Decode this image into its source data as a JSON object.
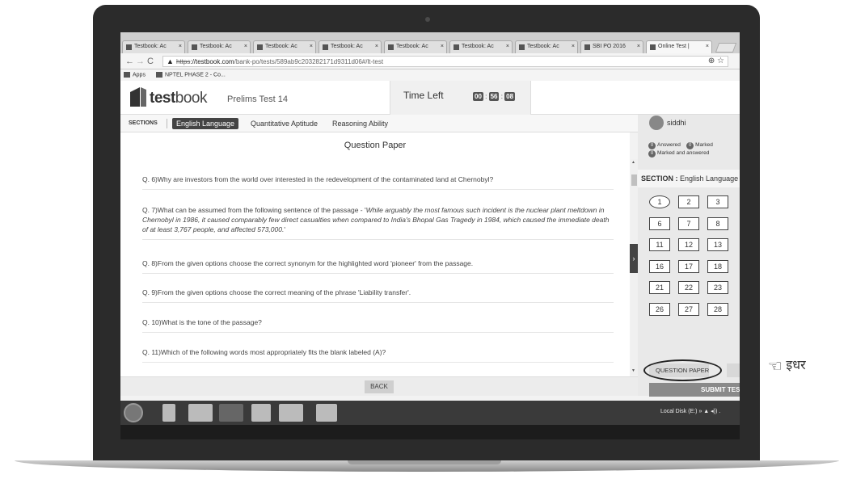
{
  "browser": {
    "tabs": [
      {
        "label": "Testbook: Ac",
        "active": false
      },
      {
        "label": "Testbook: Ac",
        "active": false
      },
      {
        "label": "Testbook: Ac",
        "active": false
      },
      {
        "label": "Testbook: Ac",
        "active": false
      },
      {
        "label": "Testbook: Ac",
        "active": false
      },
      {
        "label": "Testbook: Ac",
        "active": false
      },
      {
        "label": "Testbook: Ac",
        "active": false
      },
      {
        "label": "SBI PO 2016",
        "active": false
      },
      {
        "label": "Online Test |",
        "active": true
      }
    ],
    "url_scheme": "https",
    "url_host": "://testbook.com",
    "url_path": "/bank-po/tests/589ab9c203282171d9311d06#/lt-test",
    "bookmarks": [
      "Apps",
      "NPTEL PHASE 2 - Co..."
    ]
  },
  "header": {
    "logo_bold": "test",
    "logo_light": "book",
    "test_name": "Prelims Test 14",
    "time_label": "Time Left",
    "clock": {
      "h": "00",
      "m": "56",
      "s": "08"
    }
  },
  "sections": {
    "label": "SECTIONS",
    "tabs": [
      "English Language",
      "Quantitative Aptitude",
      "Reasoning Ability"
    ],
    "active_index": 0
  },
  "question_paper": {
    "title": "Question Paper",
    "questions": [
      {
        "prefix": "Q. 6)",
        "text": "Why are investors from the world over interested in the redevelopment of the contaminated land at Chernobyl?"
      },
      {
        "prefix": "Q. 7)",
        "text": "What can be assumed from the following sentence of the passage - '",
        "italic": "While arguably the most famous such incident is the nuclear plant meltdown in Chernobyl in 1986, it caused comparably few direct casualties when compared to India's Bhopal Gas Tragedy in 1984, which caused the immediate death of at least 3,767 people, and affected 573,000.",
        "suffix": "'"
      },
      {
        "prefix": "Q. 8)",
        "text": "From the given options choose the correct synonym for the highlighted word 'pioneer' from the passage."
      },
      {
        "prefix": "Q. 9)",
        "text": "From the given options choose the correct meaning of the phrase 'Liability transfer'."
      },
      {
        "prefix": "Q. 10)",
        "text": "What is the tone of the passage?"
      },
      {
        "prefix": "Q. 11)",
        "text": "Which of the following words most appropriately fits the blank labeled (A)?"
      }
    ],
    "back_label": "BACK"
  },
  "sidebar": {
    "user_name": "siddhi",
    "answered_count": "0",
    "answered_label": "Answered",
    "marked_count": "0",
    "marked_label": "Marked",
    "marked_answered_count": "0",
    "marked_answered_label": "Marked and answered",
    "section_prefix": "SECTION :",
    "section_name": "English Language",
    "question_numbers": [
      "1",
      "2",
      "3",
      "6",
      "7",
      "8",
      "11",
      "12",
      "13",
      "16",
      "17",
      "18",
      "21",
      "22",
      "23",
      "26",
      "27",
      "28"
    ],
    "question_paper_button": "QUESTION PAPER",
    "submit_button": "SUBMIT TEST"
  },
  "taskbar": {
    "tray_text": "Local Disk (E:)"
  },
  "annotation": {
    "hand": "☜",
    "text": "इधर"
  }
}
